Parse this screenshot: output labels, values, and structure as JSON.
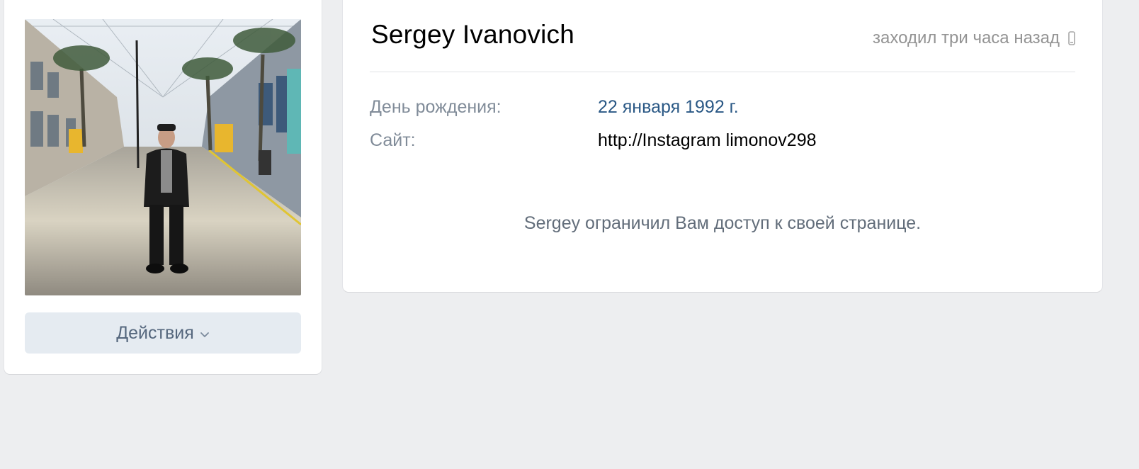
{
  "profile": {
    "name": "Sergey Ivanovich",
    "last_seen": "заходил три часа назад",
    "last_seen_icon": "mobile-phone-icon",
    "photo_description_icon": "profile-photo",
    "actions_label": "Действия",
    "actions_icon": "chevron-down-icon"
  },
  "info": [
    {
      "label": "День рождения:",
      "value": "22 января 1992 г.",
      "is_link": true
    },
    {
      "label": "Сайт:",
      "value": "http://Instagram limonov298",
      "is_link": false
    }
  ],
  "restricted_message": "Sergey ограничил Вам доступ к своей странице.",
  "colors": {
    "background": "#edeef0",
    "card": "#ffffff",
    "link": "#2a5885",
    "button_bg": "#e5ebf1",
    "button_text": "#55677d",
    "muted": "#939393"
  }
}
